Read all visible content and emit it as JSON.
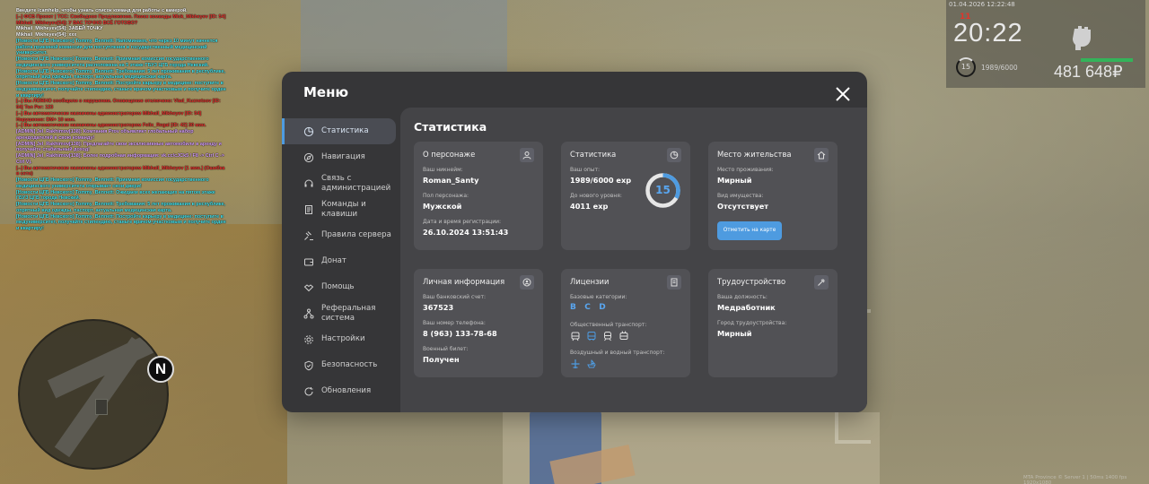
{
  "chat": {
    "lines": [
      {
        "text": "Введите /camhelp, чтобы узнать список команд для работы с камерой.",
        "color": "#ffffff"
      },
      {
        "text": "[--] ФСБ Проект | ТСС: Свободное Предложение. Поиск команды Mick_Mikheyev [ID: 54]",
        "color": "#e8322e"
      },
      {
        "text": "Mikhail_Mikheyev[54]: У ВАС ТОЧНО ВСЁ ГОТОВО?",
        "color": "#e8322e"
      },
      {
        "text": "Mikhail_Mikheyev[54]: ЗАБЕЙ ТОЧКУ",
        "color": "#ffffff"
      },
      {
        "text": "Mikhail_Mikheyev[54]: ххх",
        "color": "#ffffff"
      },
      {
        "text": "[Новости ЦГБ Невского] Tommy_Bennett: Напоминаем, что через 10 минут начнется работа приемной комиссии для поступления в государственный медицинский университет.",
        "color": "#46e6f0"
      },
      {
        "text": "[Новости ЦГБ Невского] Tommy_Bennett: Приемная комиссия государственного медицинского университета расположена на 5 этаже ГБУЗ ЦГБ города Невский.",
        "color": "#46e6f0"
      },
      {
        "text": "[Новости ЦГБ Невского] Tommy_Bennett: Требования: 5 лет проживания в республике, опрятный вид одежды, паспорт, актуальная медицинская карта.",
        "color": "#46e6f0"
      },
      {
        "text": "[Новости ЦГБ Невского] Tommy_Bennett: Постройте карьеру в медицине: поступите в медуниверситет, получайте стипендию, станьте врачом-участковым и получите орден и квартиру!",
        "color": "#46e6f0"
      },
      {
        "text": "[--] Вы ЛОЖНО сообщили о нарушении. Оповещение отключено: Vlad_Kuznetsov [ID: 54] Тел Рег: 123",
        "color": "#e8322e"
      },
      {
        "text": "[--] Вы автоматически назначены администратором Mikhail_Mikheyev [ID: 54] Нарушение: DM+ 10 мин.",
        "color": "#e8322e"
      },
      {
        "text": "[--] Вы автоматически назначены администратором Felix_Regal [ID: 42] 30 мин.",
        "color": "#e8322e"
      },
      {
        "text": "[ADMIN] Jel_Rakhimov[138]: Компания Prov объявляет глобальный набор арендодателей в свою команду!",
        "color": "#d9a2ff"
      },
      {
        "text": "[ADMIN] Jel_Rakhimov[138]: Предлагайте свои эксклюзивные автомобили в аренду и получайте стабильный доход!",
        "color": "#d9a2ff"
      },
      {
        "text": "[ADMIN] Jel_Rakhimov[138]: Более подробная информация: vk.cc/cJCk5 / F8 -> Ctrl C -> Ctrl V).",
        "color": "#d9a2ff"
      },
      {
        "text": "[--] Вы автоматически назначены администратором Mikhail_Mikheyev [1 мин.] (Ошибка в сети)",
        "color": "#e8322e"
      },
      {
        "text": "[Новости ЦГБ Невского] Tommy_Bennett: Приемная комиссия государственного медицинского университета открывает свои двери!",
        "color": "#46e6f0"
      },
      {
        "text": "[Новости ЦГБ Невского] Tommy_Bennett: Ожидаем всех желающих на пятом этаже ГБУЗ ЦГБ города Невский.",
        "color": "#46e6f0"
      },
      {
        "text": "[Новости ЦГБ Невского] Tommy_Bennett: Требования: 5 лет проживания в республике, опрятный вид одежды, паспорт, актуальная медицинская карта.",
        "color": "#46e6f0"
      },
      {
        "text": "[Новости ЦГБ Невского] Tommy_Bennett: Постройте карьеру в медицине: поступите в медуниверситет, получайте стипендию, станьте врачом-участковым и получите орден и квартиру!",
        "color": "#46e6f0"
      }
    ]
  },
  "hud": {
    "date": "01.04.2026 12:22:48",
    "counter": "11",
    "time": "20:22",
    "level": "15",
    "exp": "1989/6000",
    "money": "481 648₽",
    "hp_fraction": 1.0
  },
  "minimap": {
    "north_label": "N"
  },
  "watermark": "MTA Province © Server 1 | 50ms 1400 fps 1920x1080",
  "menu": {
    "title": "Меню",
    "nav": [
      {
        "key": "stats",
        "label": "Статистика",
        "icon": "pie-chart-icon",
        "active": true
      },
      {
        "key": "navigation",
        "label": "Навигация",
        "icon": "compass-icon",
        "active": false
      },
      {
        "key": "admin",
        "label": "Связь с администрацией",
        "icon": "headset-icon",
        "active": false
      },
      {
        "key": "commands",
        "label": "Команды и клавиши",
        "icon": "document-icon",
        "active": false
      },
      {
        "key": "rules",
        "label": "Правила сервера",
        "icon": "gavel-icon",
        "active": false
      },
      {
        "key": "donate",
        "label": "Донат",
        "icon": "wallet-icon",
        "active": false
      },
      {
        "key": "help",
        "label": "Помощь",
        "icon": "handshake-icon",
        "active": false
      },
      {
        "key": "referral",
        "label": "Реферальная система",
        "icon": "network-icon",
        "active": false
      },
      {
        "key": "settings",
        "label": "Настройки",
        "icon": "gear-icon",
        "active": false
      },
      {
        "key": "security",
        "label": "Безопасность",
        "icon": "shield-icon",
        "active": false
      },
      {
        "key": "updates",
        "label": "Обновления",
        "icon": "refresh-icon",
        "active": false
      }
    ],
    "content": {
      "heading": "Статистика",
      "about": {
        "title": "О персонаже",
        "nick_label": "Ваш никнейм:",
        "nick": "Roman_Santy",
        "gender_label": "Пол персонажа:",
        "gender": "Мужской",
        "reg_label": "Дата и время регистрации:",
        "reg": "26.10.2024 13:51:43"
      },
      "stats": {
        "title": "Статистика",
        "exp_label": "Ваш опыт:",
        "exp": "1989/6000 exp",
        "next_label": "До нового уровня:",
        "next": "4011 exp",
        "level": "15",
        "progress_fraction": 0.3315
      },
      "residence": {
        "title": "Место жительства",
        "place_label": "Место проживания:",
        "place": "Мирный",
        "property_label": "Вид имущества:",
        "property": "Отсутствует",
        "button": "Отметить на карте"
      },
      "personal": {
        "title": "Личная информация",
        "bank_label": "Ваш банковский счет:",
        "bank": "367523",
        "phone_label": "Ваш номер телефона:",
        "phone": "8 (963) 133-78-68",
        "military_label": "Военный билет:",
        "military": "Получен"
      },
      "licenses": {
        "title": "Лицензии",
        "base_label": "Базовые категории:",
        "categories": [
          "B",
          "C",
          "D"
        ],
        "public_label": "Общественный транспорт:",
        "public_icons": [
          "tram-icon",
          "bus-icon",
          "train-icon",
          "trolleybus-icon"
        ],
        "air_label": "Воздушный и водный транспорт:",
        "air_icons": [
          "plane-icon",
          "boat-icon"
        ]
      },
      "employment": {
        "title": "Трудоустройство",
        "position_label": "Ваша должность:",
        "position": "Медработник",
        "city_label": "Город трудоустройства:",
        "city": "Мирный"
      }
    }
  }
}
